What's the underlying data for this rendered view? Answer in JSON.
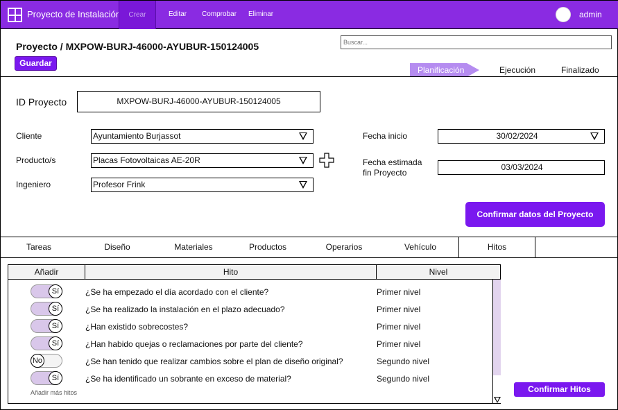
{
  "topbar": {
    "app_title": "Proyecto de Instalación",
    "menu": {
      "crear": "Crear",
      "editar": "Editar",
      "comprobar": "Comprobar",
      "eliminar": "Eliminar"
    },
    "user": "admin",
    "color": "#8a2be2"
  },
  "header": {
    "title": "Proyecto / MXPOW-BURJ-46000-AYUBUR-150124005",
    "save_label": "Guardar",
    "search_placeholder": "Buscar...",
    "steps": [
      "Planificación",
      "Ejecución",
      "Finalizado"
    ],
    "active_step": "Planificación"
  },
  "form": {
    "id_label": "ID Proyecto",
    "id_value": "MXPOW-BURJ-46000-AYUBUR-150124005",
    "cliente_label": "Cliente",
    "cliente_value": "Ayuntamiento Burjassot",
    "producto_label": "Producto/s",
    "producto_value": "Placas Fotovoltaicas AE-20R",
    "ingeniero_label": "Ingeniero",
    "ingeniero_value": "Profesor Frink",
    "fecha_inicio_label": "Fecha inicio",
    "fecha_inicio_value": "30/02/2024",
    "fecha_fin_label_1": "Fecha estimada",
    "fecha_fin_label_2": "fin Proyecto",
    "fecha_fin_value": "03/03/2024",
    "confirm_label": "Confirmar datos del Proyecto"
  },
  "tabs": [
    "Tareas",
    "Diseño",
    "Materiales",
    "Productos",
    "Operarios",
    "Vehículo",
    "Hitos"
  ],
  "active_tab": "Hitos",
  "table": {
    "headers": {
      "add": "Añadir",
      "hito": "Hito",
      "nivel": "Nivel"
    },
    "rows": [
      {
        "toggle": "Sí",
        "on": true,
        "hito": "¿Se ha empezado el día acordado con el cliente?",
        "nivel": "Primer nivel"
      },
      {
        "toggle": "Sí",
        "on": true,
        "hito": "¿Se ha realizado la instalación en el plazo adecuado?",
        "nivel": "Primer nivel"
      },
      {
        "toggle": "Sí",
        "on": true,
        "hito": "¿Han existido sobrecostes?",
        "nivel": "Primer nivel"
      },
      {
        "toggle": "Sí",
        "on": true,
        "hito": "¿Han habido quejas o reclamaciones por parte del cliente?",
        "nivel": "Primer nivel"
      },
      {
        "toggle": "No",
        "on": false,
        "hito": "¿Se han tenido que realizar cambios sobre el plan de diseño original?",
        "nivel": "Segundo nivel"
      },
      {
        "toggle": "Sí",
        "on": true,
        "hito": "¿Se ha identificado un sobrante en exceso de material?",
        "nivel": "Segundo nivel"
      }
    ],
    "more_label": "Añadir más hitos"
  },
  "confirm_hitos_label": "Confirmar Hitos"
}
